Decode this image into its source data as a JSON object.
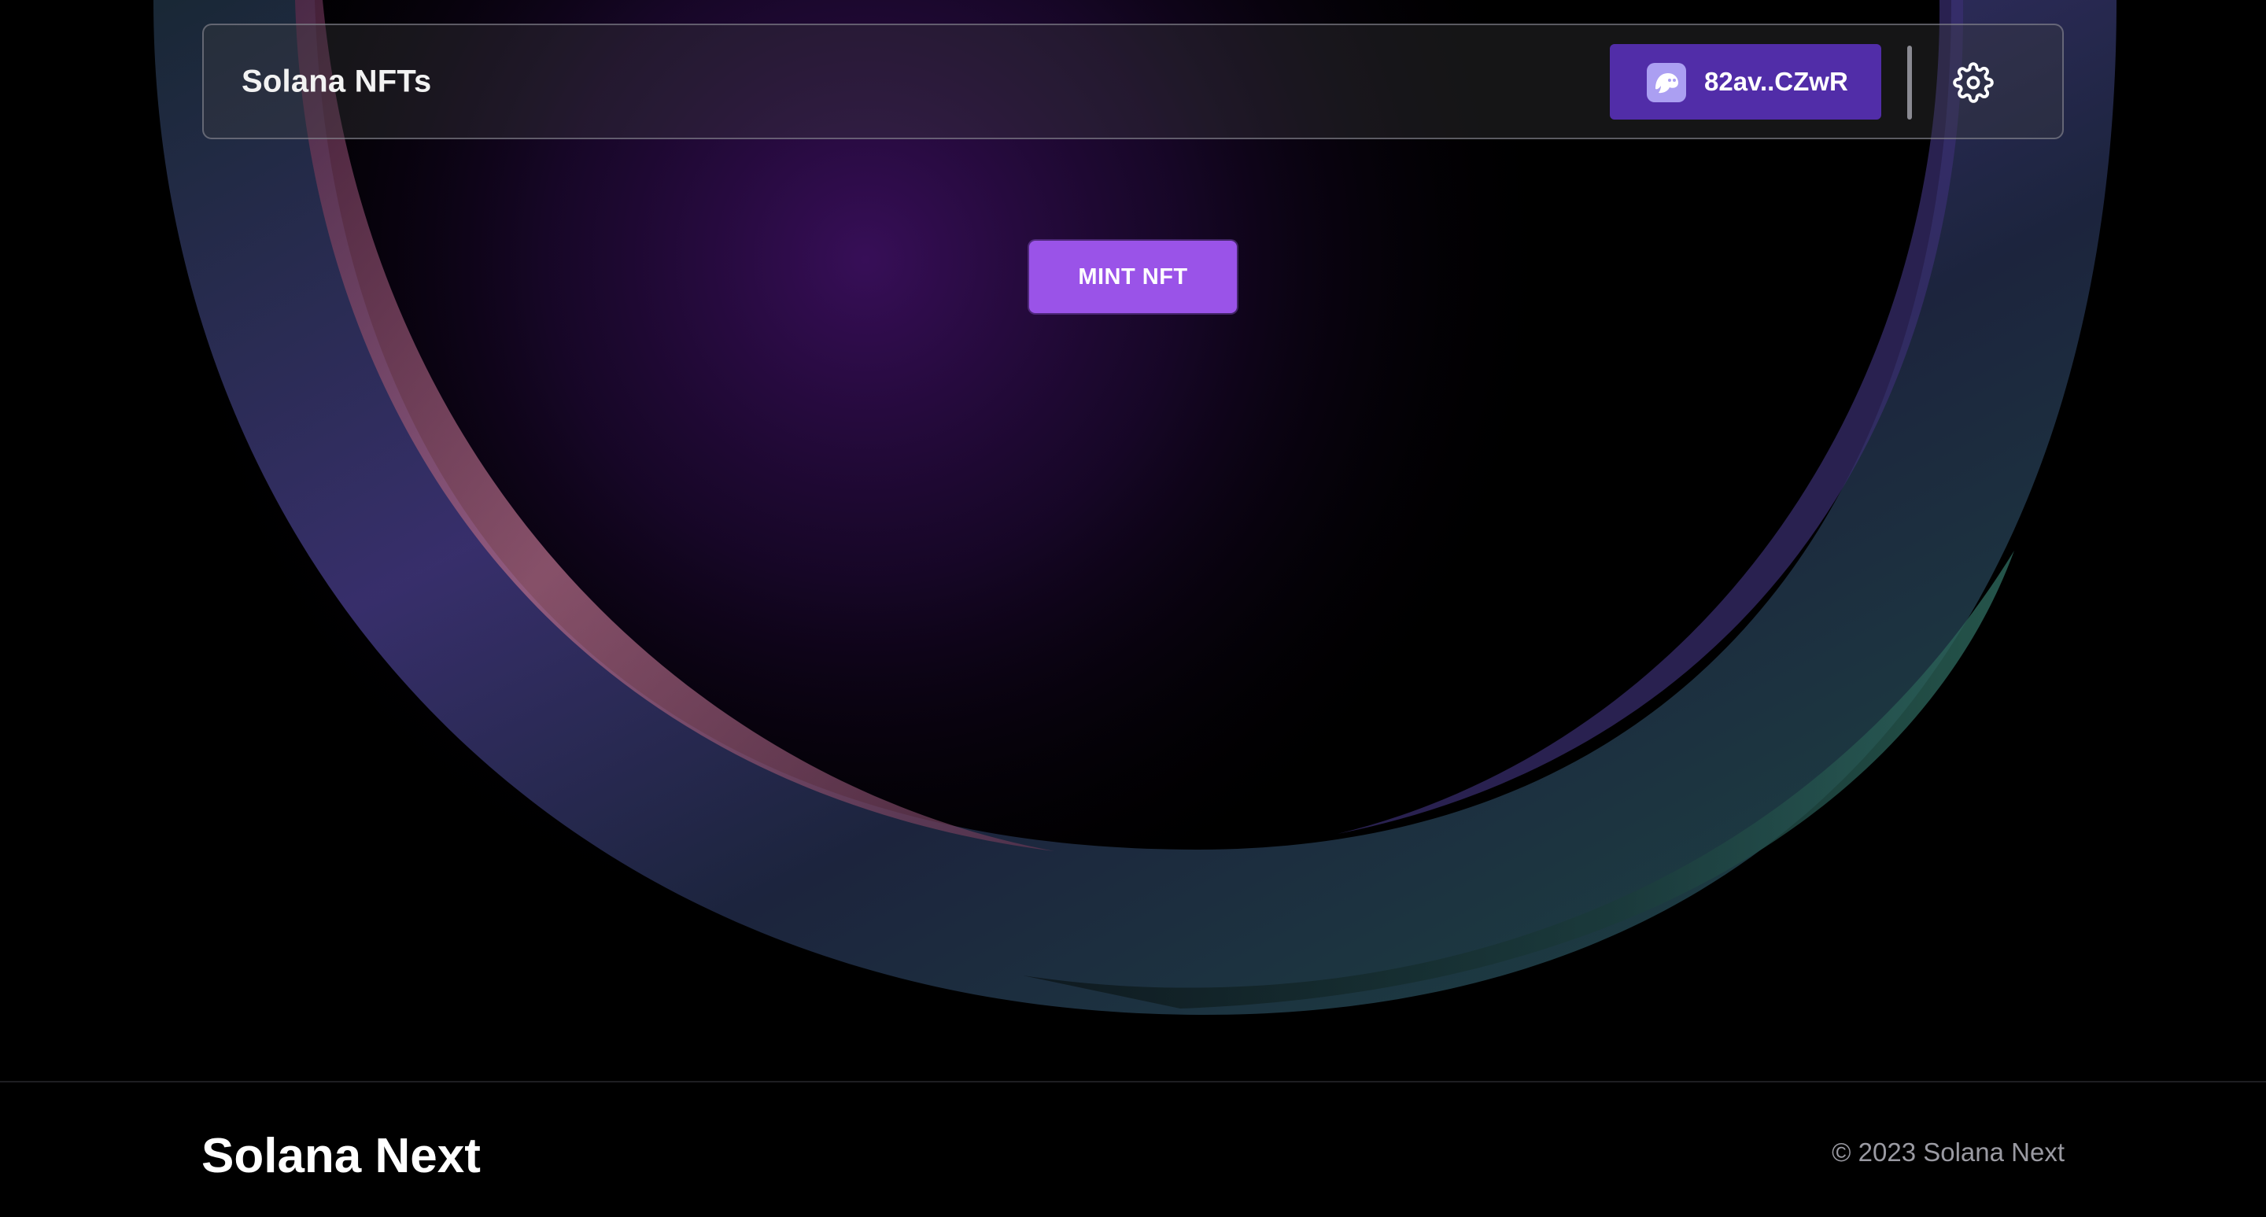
{
  "navbar": {
    "title": "Solana NFTs",
    "wallet": {
      "address": "82av..CZwR",
      "icon": "phantom-ghost-icon"
    },
    "settings_icon": "gear-icon"
  },
  "main": {
    "mint_label": "MINT NFT"
  },
  "footer": {
    "brand": "Solana Next",
    "copyright": "© 2023 Solana Next"
  },
  "colors": {
    "background": "#000000",
    "wallet_button": "#512da8",
    "mint_button": "#9a53e8",
    "wallet_icon_bg": "#ab9ff2"
  }
}
